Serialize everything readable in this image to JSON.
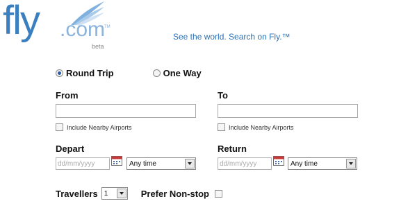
{
  "logo": {
    "fly": "fly",
    "com": ".com",
    "tm": "TM",
    "beta": "beta",
    "icon": "wing-icon"
  },
  "tagline": "See the world. Search on Fly.™",
  "trip_type": {
    "round_trip": "Round Trip",
    "one_way": "One Way",
    "selected": "Round Trip"
  },
  "from": {
    "label": "From",
    "value": "",
    "nearby_label": "Include Nearby Airports"
  },
  "to": {
    "label": "To",
    "value": "",
    "nearby_label": "Include Nearby Airports"
  },
  "depart": {
    "label": "Depart",
    "date_placeholder": "dd/mm/yyyy",
    "time_value": "Any time"
  },
  "return": {
    "label": "Return",
    "date_placeholder": "dd/mm/yyyy",
    "time_value": "Any time"
  },
  "travellers": {
    "label": "Travellers",
    "value": "1"
  },
  "prefer_nonstop": {
    "label": "Prefer Non-stop",
    "checked": false
  },
  "colors": {
    "brand_blue": "#3a7fbf",
    "tagline_blue": "#2a6fb4"
  }
}
